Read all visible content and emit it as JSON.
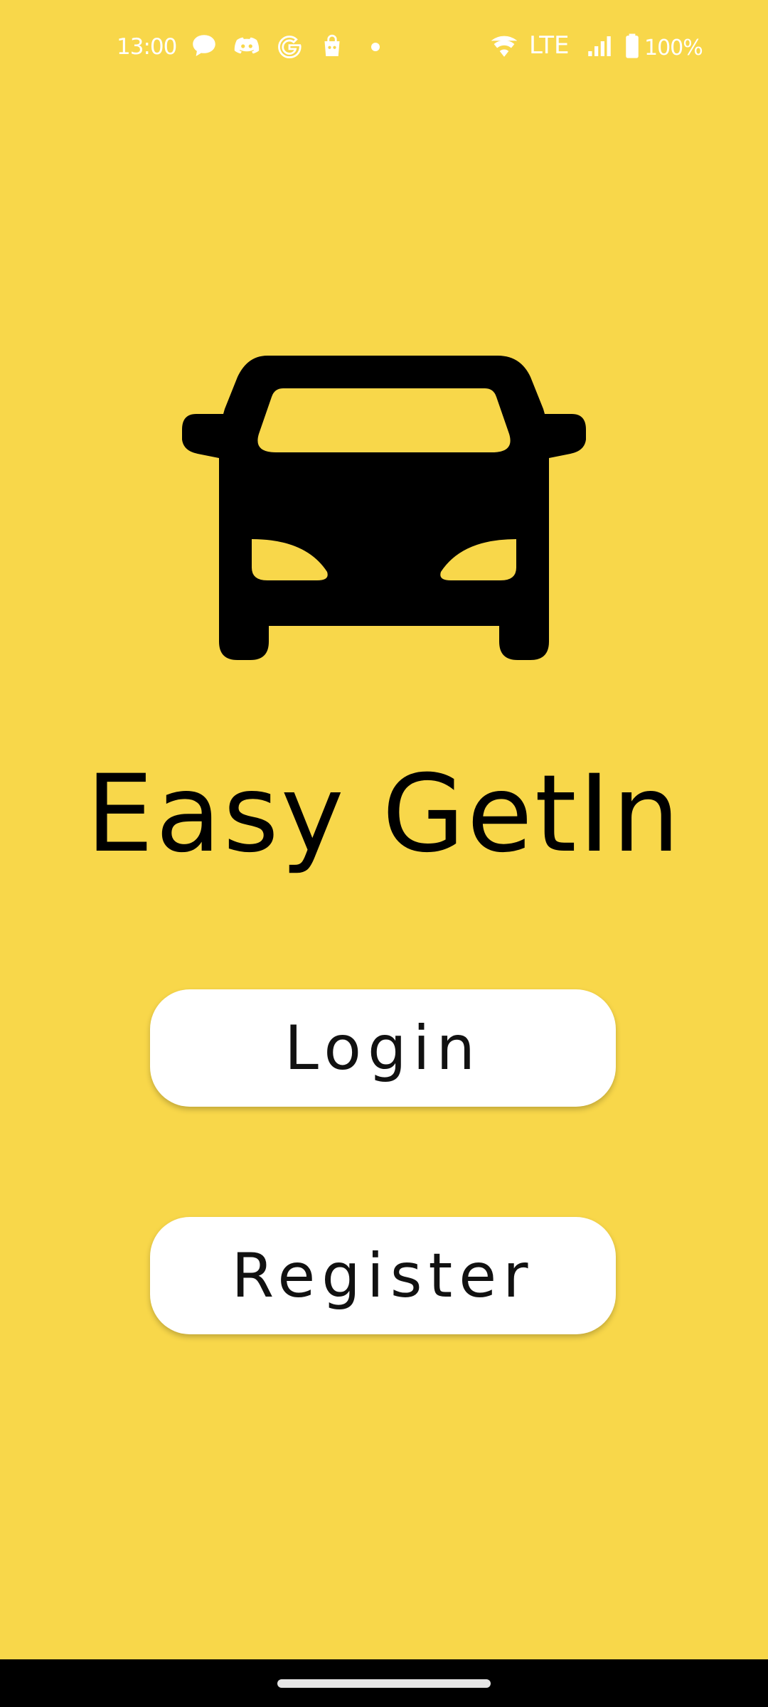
{
  "status_bar": {
    "time": "13:00",
    "network": "LTE",
    "battery": "100%",
    "icons": [
      "chat-bubble-icon",
      "discord-icon",
      "google-icon",
      "shopping-bag-icon",
      "notification-dot-icon",
      "wifi-icon",
      "signal-icon",
      "battery-icon"
    ],
    "icon_color": "#FFFFFF"
  },
  "app": {
    "title": "Easy GetIn",
    "logo": "car-icon",
    "background_color": "#F8D74A",
    "logo_color": "#000000"
  },
  "buttons": {
    "login_label": "Login",
    "register_label": "Register",
    "background_color": "#FFFFFF"
  },
  "nav_bar": {
    "background_color": "#000000",
    "handle": "home-gesture-handle"
  }
}
